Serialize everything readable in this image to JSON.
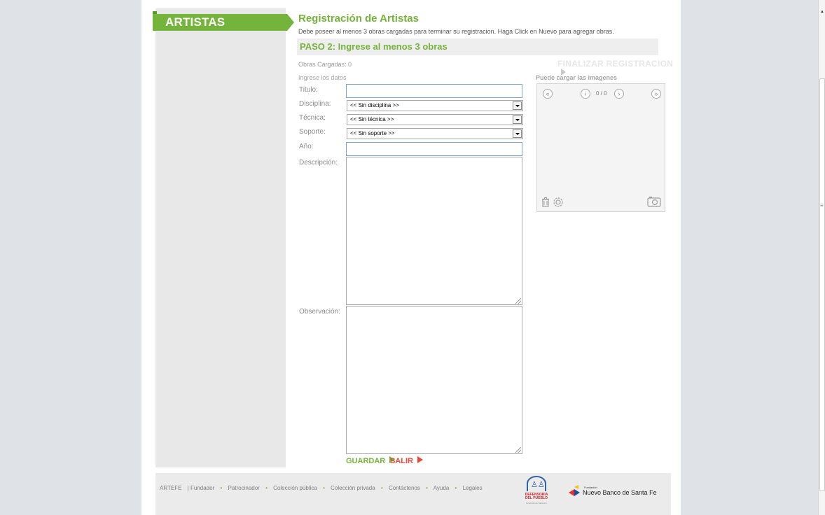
{
  "sidebar": {
    "tab_label": "ARTISTAS"
  },
  "header": {
    "title": "Registración de Artistas",
    "subtitle": "Debe poseer al menos 3 obras cargadas para terminar su registracion. Haga Click en Nuevo para agregar obras."
  },
  "step": {
    "title": "PASO 2: Ingrese al menos 3 obras"
  },
  "status": {
    "obras_cargadas": "Obras Cargadas: 0",
    "finalizar_label": "FINALIZAR REGISTRACION"
  },
  "form": {
    "section_label": "Ingrese los datos",
    "titulo_label": "Titulo:",
    "titulo_value": "",
    "disciplina_label": "Disciplina:",
    "disciplina_value": "<< Sin disciplina >>",
    "tecnica_label": "Técnica:",
    "tecnica_value": "<< Sin técnica >>",
    "soporte_label": "Soporte:",
    "soporte_value": "<< Sin soporte >>",
    "anio_label": "Año:",
    "anio_value": "",
    "descripcion_label": "Descripción:",
    "observacion_label": "Observación:",
    "guardar_label": "GUARDAR",
    "salir_label": "SALIR"
  },
  "images": {
    "section_label": "Puede cargar las imagenes",
    "counter": "0 / 0",
    "first_icon": "double-left-arrow-icon",
    "prev_icon": "left-arrow-icon",
    "next_icon": "right-arrow-icon",
    "last_icon": "double-right-arrow-icon",
    "trash_icon": "trash-icon",
    "settings_icon": "gear-icon",
    "camera_icon": "camera-icon"
  },
  "footer": {
    "links": [
      "ARTEFE",
      "| Fundador",
      "Patrocinador",
      "Colección pública",
      "Colección privada",
      "Contáctenos",
      "Ayuda",
      "Legales"
    ],
    "defensoria_name": "DEFENSORIA DEL PUEBLO",
    "defensoria_sub": "Provincia de Santa Fe",
    "bank_pre": "Fundación",
    "bank_name": "Nuevo Banco de Santa Fe"
  },
  "colors": {
    "accent_green": "#74b43a",
    "accent_red": "#e74a3a",
    "input_border": "#7ea4c8"
  }
}
